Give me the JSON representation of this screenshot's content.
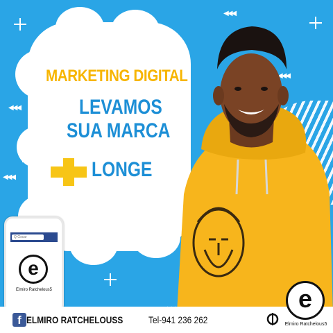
{
  "headline": {
    "line1": "MARKETING DIGITAL",
    "line2": "LEVAMOS",
    "line3": "SUA MARCA",
    "line4": "LONGE"
  },
  "phone": {
    "search_text": "Q Gscar",
    "brand_name": "Elmiro Ratchelous5"
  },
  "footer": {
    "facebook_icon": "f",
    "facebook_name": "ELMIRO RATCHELOUSS",
    "phone": "Tel-941 236 262",
    "brand_name": "Elmiro Ratchelous5"
  },
  "logo_letter": "e",
  "colors": {
    "background": "#2aa5e6",
    "headline_yellow": "#f7b500",
    "headline_blue": "#1d8fd6",
    "hoodie": "#f7b51c",
    "facebook": "#3b5998"
  },
  "arrow_glyph": "◀◀◀"
}
